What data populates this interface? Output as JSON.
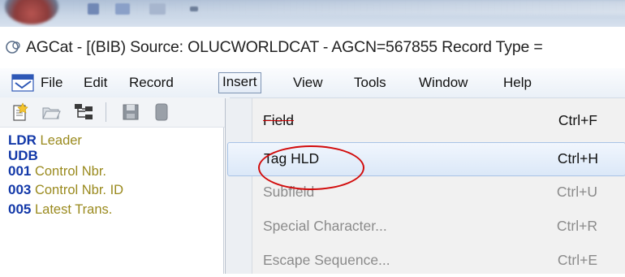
{
  "window": {
    "title": "AGCat - [(BIB) Source: OLUCWORLDCAT - AGCN=567855 Record Type ="
  },
  "menubar": {
    "items": [
      {
        "label": "File"
      },
      {
        "label": "Edit"
      },
      {
        "label": "Record"
      },
      {
        "label": "Insert",
        "selected": true
      },
      {
        "label": "View"
      },
      {
        "label": "Tools"
      },
      {
        "label": "Window"
      },
      {
        "label": "Help"
      }
    ]
  },
  "toolbar": {
    "buttons": [
      "new-record-icon",
      "open-folder-icon",
      "hierarchy-icon",
      "save-icon",
      "record-icon"
    ]
  },
  "record_list": [
    {
      "tag": "LDR",
      "desc": "Leader"
    },
    {
      "tag": "UDB",
      "desc": ""
    },
    {
      "tag": "001",
      "desc": "Control Nbr."
    },
    {
      "tag": "003",
      "desc": "Control Nbr. ID"
    },
    {
      "tag": "005",
      "desc": "Latest Trans."
    }
  ],
  "insert_menu": {
    "items": [
      {
        "label": "Field",
        "shortcut": "Ctrl+F",
        "enabled": true
      },
      {
        "label": "Tag HLD",
        "shortcut": "Ctrl+H",
        "enabled": true,
        "highlighted": true
      },
      {
        "label": "Subfield",
        "shortcut": "Ctrl+U",
        "enabled": false
      },
      {
        "label": "Special Character...",
        "shortcut": "Ctrl+R",
        "enabled": false
      },
      {
        "label": "Escape Sequence...",
        "shortcut": "Ctrl+E",
        "enabled": false
      }
    ]
  },
  "colors": {
    "tag": "#1238a8",
    "desc": "#9a8a1e",
    "annotation": "#d20c0c"
  }
}
